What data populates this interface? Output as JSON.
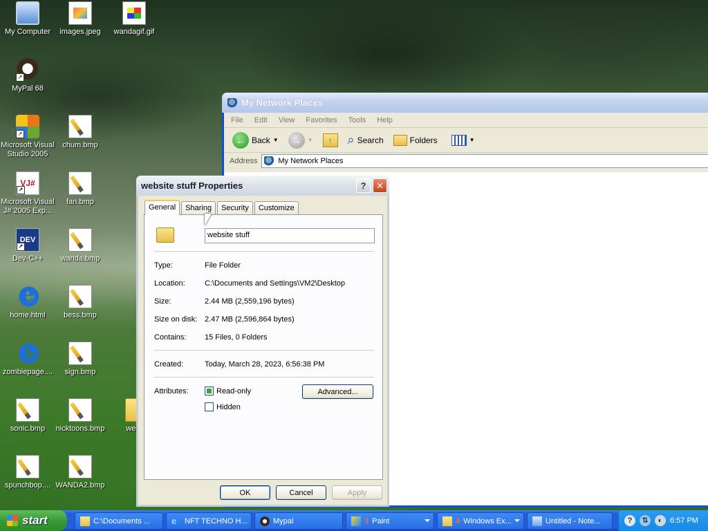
{
  "desktop": {
    "icons": [
      {
        "label": "My Computer",
        "icon": "computer-icon"
      },
      {
        "label": "images.jpeg",
        "icon": "jpeg-image-icon"
      },
      {
        "label": "wandagif.gif",
        "icon": "gif-image-icon"
      },
      {
        "label": "MyPal 68",
        "icon": "mypal-icon"
      },
      {
        "label": "Microsoft Visual Studio 2005",
        "icon": "visual-studio-icon"
      },
      {
        "label": "chum.bmp",
        "icon": "bitmap-icon"
      },
      {
        "label": "Microsoft Visual J# 2005 Exp...",
        "icon": "visual-jsharp-icon"
      },
      {
        "label": "fan.bmp",
        "icon": "bitmap-icon"
      },
      {
        "label": "Dev-C++",
        "icon": "devcpp-icon"
      },
      {
        "label": "wanda.bmp",
        "icon": "bitmap-icon"
      },
      {
        "label": "home.html",
        "icon": "internet-explorer-icon"
      },
      {
        "label": "bess.bmp",
        "icon": "bitmap-icon"
      },
      {
        "label": "zombiepage....",
        "icon": "internet-explorer-icon"
      },
      {
        "label": "sign.bmp",
        "icon": "bitmap-icon"
      },
      {
        "label": "sonic.bmp",
        "icon": "bitmap-icon"
      },
      {
        "label": "nicktoons.bmp",
        "icon": "bitmap-icon"
      },
      {
        "label": "websit",
        "icon": "folder-icon"
      },
      {
        "label": "spunchbop....",
        "icon": "bitmap-icon"
      },
      {
        "label": "WANDA2.bmp",
        "icon": "bitmap-icon"
      }
    ],
    "devcpp_glyph": "DEV",
    "vj_glyph": "VJ#"
  },
  "explorer": {
    "title": "My Network Places",
    "menu": [
      "File",
      "Edit",
      "View",
      "Favorites",
      "Tools",
      "Help"
    ],
    "toolbar": {
      "back": "Back",
      "search": "Search",
      "folders": "Folders"
    },
    "address_label": "Address",
    "address_value": "My Network Places"
  },
  "dialog": {
    "title": "website stuff Properties",
    "help_glyph": "?",
    "close_glyph": "✕",
    "tabs": [
      "General",
      "Sharing",
      "Security",
      "Customize"
    ],
    "active_tab": "General",
    "name_value": "website stuff",
    "fields": {
      "type_label": "Type:",
      "type_value": "File Folder",
      "location_label": "Location:",
      "location_value": "C:\\Documents and Settings\\VM2\\Desktop",
      "size_label": "Size:",
      "size_value": "2.44 MB (2,559,196 bytes)",
      "size_on_disk_label": "Size on disk:",
      "size_on_disk_value": "2.47 MB (2,596,864 bytes)",
      "contains_label": "Contains:",
      "contains_value": "15 Files, 0 Folders",
      "created_label": "Created:",
      "created_value": "Today, March 28, 2023, 6:56:38 PM",
      "attributes_label": "Attributes:"
    },
    "attributes": {
      "readonly_label": "Read-only",
      "readonly_state": "mixed",
      "hidden_label": "Hidden",
      "hidden_state": "unchecked"
    },
    "buttons": {
      "advanced": "Advanced...",
      "ok": "OK",
      "cancel": "Cancel",
      "apply": "Apply"
    }
  },
  "taskbar": {
    "start_label": "start",
    "tasks": [
      {
        "label": "C:\\Documents ...",
        "icon": "folder-icon"
      },
      {
        "label": "NFT TECHNO H...",
        "icon": "internet-explorer-icon"
      },
      {
        "label": "Mypal",
        "icon": "mypal-icon"
      },
      {
        "count": "3",
        "label": "Paint",
        "icon": "paint-icon"
      },
      {
        "count": "4",
        "label": "Windows Ex...",
        "icon": "folder-icon"
      },
      {
        "label": "Untitled - Note...",
        "icon": "notepad-icon"
      }
    ],
    "clock": "6:57 PM"
  },
  "colors": {
    "xp_blue": "#245edb",
    "start_green": "#3a9a36",
    "dialog_face": "#ece9d8"
  }
}
